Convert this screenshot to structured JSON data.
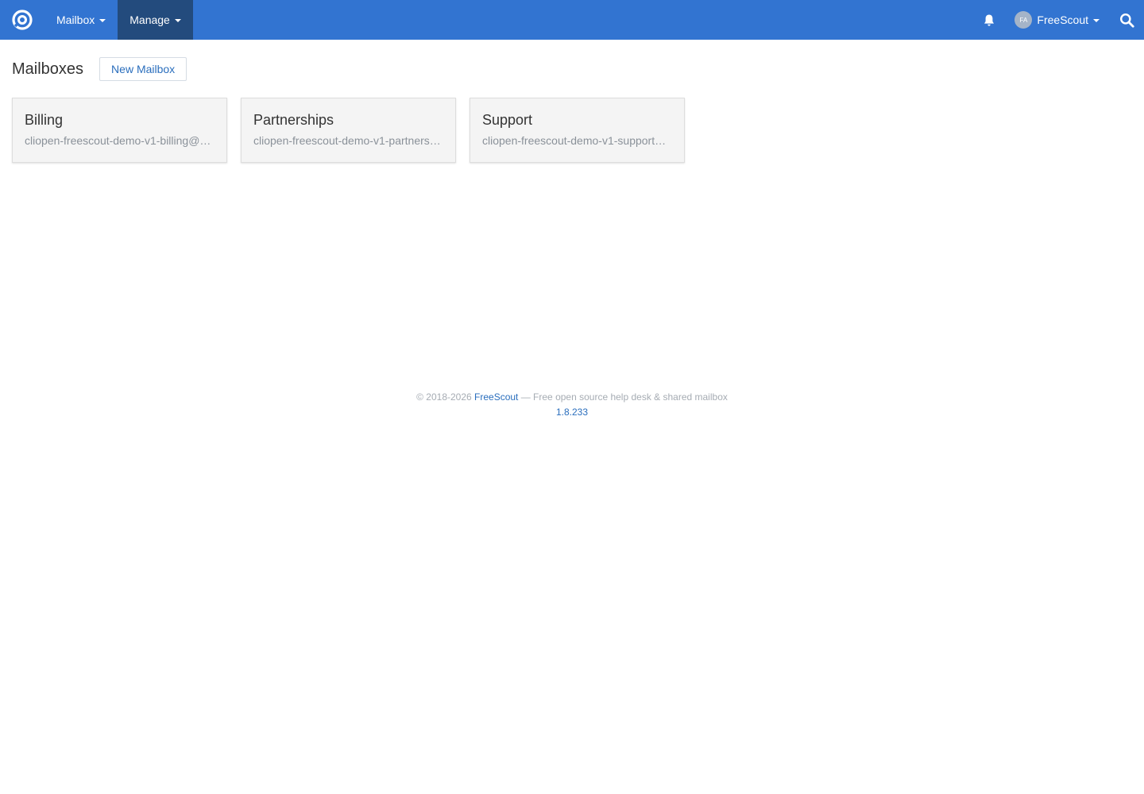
{
  "navbar": {
    "colors": {
      "background": "#3274d1",
      "active_item": "#234b7d"
    },
    "logo_icon": "freescout-logo-icon",
    "items": [
      {
        "label": "Mailbox",
        "active": false
      },
      {
        "label": "Manage",
        "active": true
      }
    ],
    "notifications_icon": "bell-icon",
    "user": {
      "initials": "FA",
      "name": "FreeScout"
    },
    "search_icon": "search-icon"
  },
  "page": {
    "title": "Mailboxes",
    "new_button_label": "New Mailbox"
  },
  "mailboxes": [
    {
      "name": "Billing",
      "email": "cliopen-freescout-demo-v1-billing@…"
    },
    {
      "name": "Partnerships",
      "email": "cliopen-freescout-demo-v1-partners…"
    },
    {
      "name": "Support",
      "email": "cliopen-freescout-demo-v1-support…"
    }
  ],
  "footer": {
    "copyright": "© 2018-2026 ",
    "brand_link": "FreeScout",
    "tagline": " — Free open source help desk & shared mailbox",
    "version": "1.8.233"
  }
}
